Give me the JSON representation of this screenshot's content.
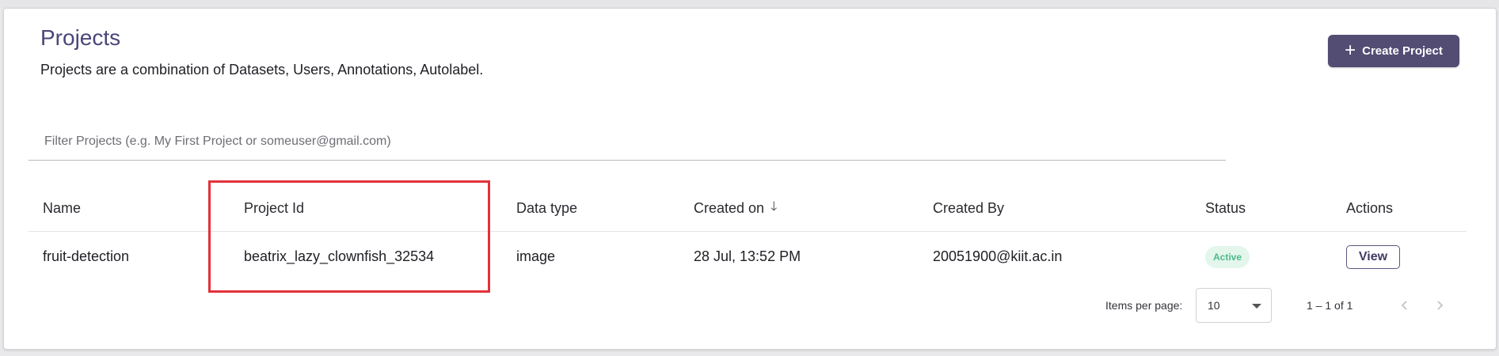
{
  "header": {
    "title": "Projects",
    "subtitle": "Projects are a combination of Datasets, Users, Annotations, Autolabel.",
    "create_button_icon": "plus-icon",
    "create_button_label": "Create Project"
  },
  "filter": {
    "placeholder": "Filter Projects (e.g. My First Project or someuser@gmail.com)",
    "value": ""
  },
  "table": {
    "columns": {
      "name": "Name",
      "project_id": "Project Id",
      "data_type": "Data type",
      "created_on": "Created on",
      "created_on_sort_icon": "arrow-down-icon",
      "created_by": "Created By",
      "status": "Status",
      "actions": "Actions"
    },
    "rows": [
      {
        "name": "fruit-detection",
        "project_id": "beatrix_lazy_clownfish_32534",
        "data_type": "image",
        "created_on": "28 Jul, 13:52 PM",
        "created_by": "20051900@kiit.ac.in",
        "status": "Active",
        "action_label": "View"
      }
    ]
  },
  "paginator": {
    "items_per_page_label": "Items per page:",
    "items_per_page_value": "10",
    "range_label": "1 – 1 of 1",
    "prev_icon": "chevron-left-icon",
    "next_icon": "chevron-right-icon"
  },
  "colors": {
    "accent": "#534c73",
    "title": "#4a467a",
    "status_active_bg": "#e3f6ec",
    "status_active_text": "#4fb98a",
    "highlight": "#e2323a"
  }
}
